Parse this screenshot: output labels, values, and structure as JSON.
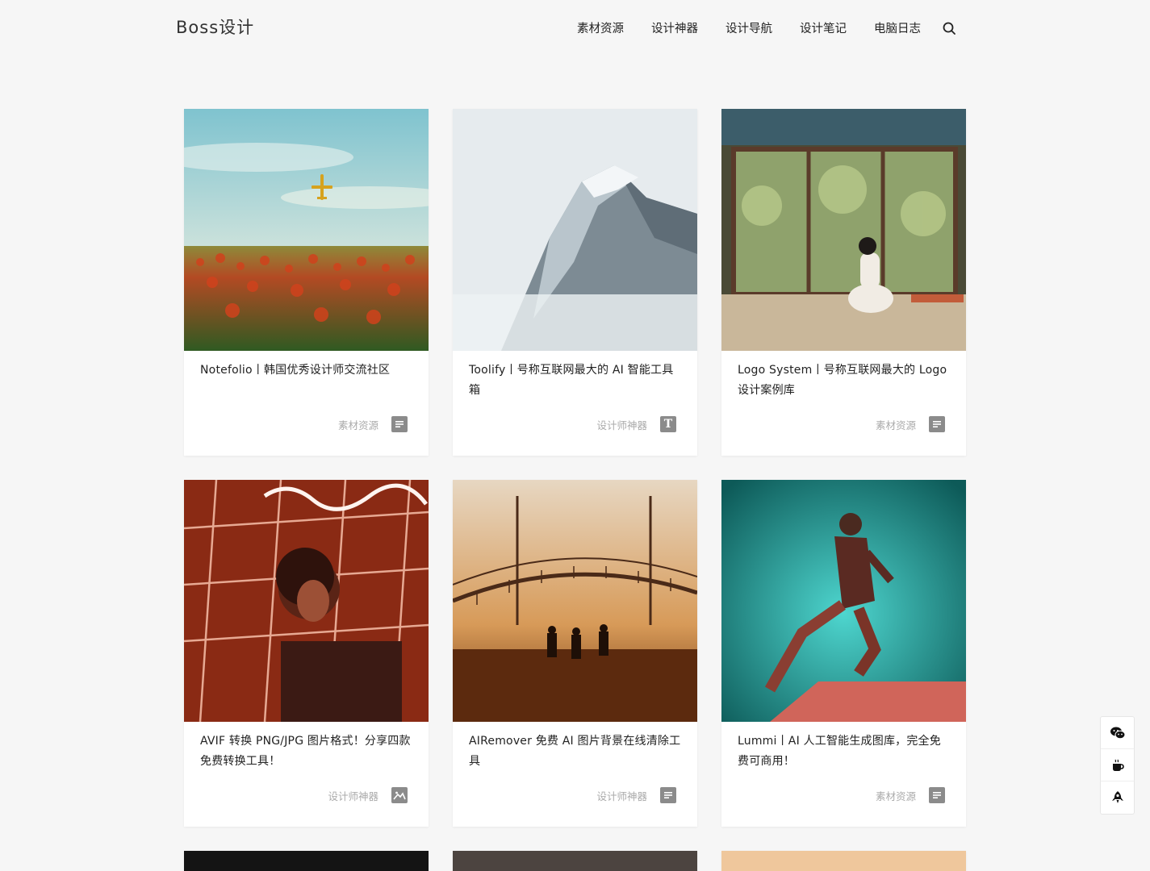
{
  "site": {
    "logo": "Boss设计"
  },
  "nav": {
    "items": [
      {
        "label": "素材资源"
      },
      {
        "label": "设计神器"
      },
      {
        "label": "设计导航"
      },
      {
        "label": "设计笔记"
      },
      {
        "label": "电脑日志"
      }
    ],
    "search_icon": "search-icon"
  },
  "cards": [
    {
      "title": "Notefolio丨韩国优秀设计师交流社区",
      "category": "素材资源",
      "icon": "document-icon"
    },
    {
      "title": "Toolify丨号称互联网最大的 AI 智能工具箱",
      "category": "设计师神器",
      "icon": "text-format-icon"
    },
    {
      "title": "Logo System丨号称互联网最大的 Logo 设计案例库",
      "category": "素材资源",
      "icon": "document-icon"
    },
    {
      "title": "AVIF 转换 PNG/JPG 图片格式！分享四款免费转换工具！",
      "category": "设计师神器",
      "icon": "image-icon"
    },
    {
      "title": "AIRemover 免费 AI 图片背景在线清除工具",
      "category": "设计师神器",
      "icon": "document-icon"
    },
    {
      "title": "Lummi丨AI 人工智能生成图库，完全免费可商用！",
      "category": "素材资源",
      "icon": "document-icon"
    }
  ],
  "side_tools": [
    "wechat-icon",
    "coffee-icon",
    "rocket-icon"
  ]
}
